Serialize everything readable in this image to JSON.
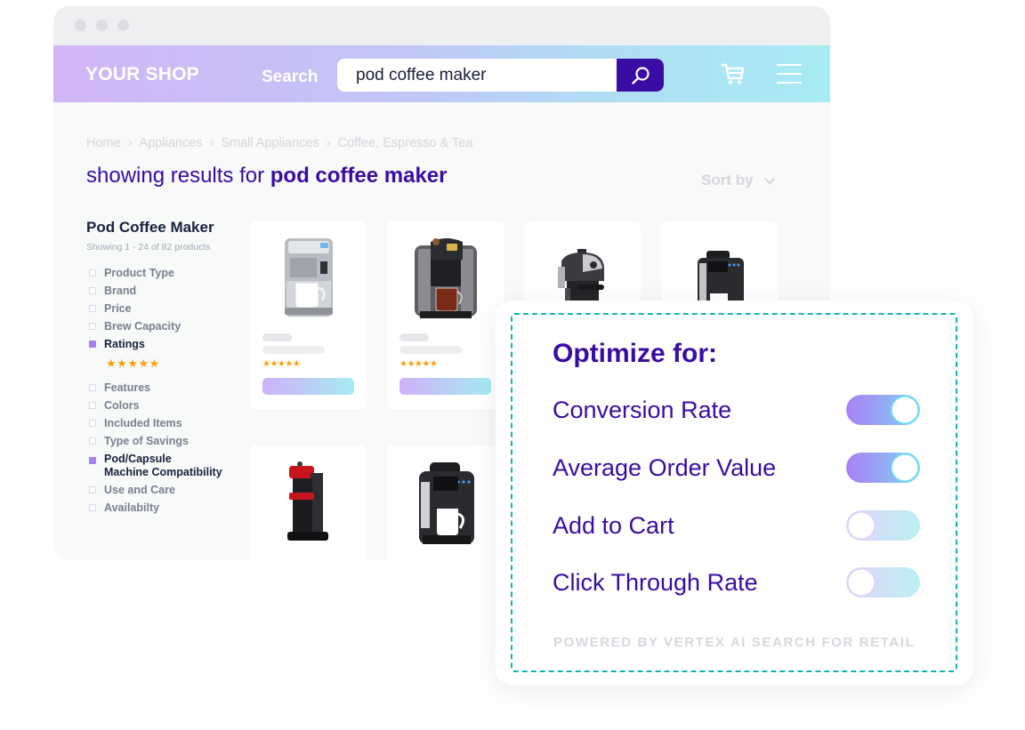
{
  "window": {
    "title_dots": [
      "close",
      "minimize",
      "maximize"
    ]
  },
  "header": {
    "brand": "YOUR SHOP",
    "search_label": "Search",
    "search_value": "pod coffee maker",
    "search_icon": "search-icon",
    "cart_icon": "cart-icon",
    "menu_icon": "hamburger-menu-icon",
    "colors": {
      "accent": "#3a0ca3",
      "gradient_start": "#d3b5f8",
      "gradient_end": "#a7ecf3"
    }
  },
  "breadcrumb": {
    "items": [
      "Home",
      "Appliances",
      "Small Appliances",
      "Coffee, Espresso & Tea"
    ],
    "separator": "›"
  },
  "results": {
    "prefix": "showing results for ",
    "query": "pod coffee maker",
    "sort_label": "Sort by"
  },
  "sidebar": {
    "title": "Pod Coffee Maker",
    "count": "Showing 1 - 24 of 82 products",
    "facets": [
      {
        "label": "Product Type",
        "checked": false
      },
      {
        "label": "Brand",
        "checked": false
      },
      {
        "label": "Price",
        "checked": false
      },
      {
        "label": "Brew Capacity",
        "checked": false
      },
      {
        "label": "Ratings",
        "checked": true,
        "stars": "★★★★★"
      },
      {
        "label": "Features",
        "checked": false
      },
      {
        "label": "Colors",
        "checked": false
      },
      {
        "label": "Included Items",
        "checked": false
      },
      {
        "label": "Type of Savings",
        "checked": false
      },
      {
        "label": "Pod/Capsule Machine Compatibility",
        "line1": "Pod/Capsule",
        "line2": "Machine Compatibility",
        "checked": true
      },
      {
        "label": "Use and Care",
        "checked": false
      },
      {
        "label": "Availabilty",
        "checked": false
      }
    ]
  },
  "products": [
    {
      "name": "silver-pod-coffee-maker",
      "rating": 5,
      "stars": "★★★★★"
    },
    {
      "name": "premium-pod-coffee-maker",
      "rating": 5,
      "stars": "★★★★★"
    },
    {
      "name": "espresso-machine"
    },
    {
      "name": "black-pod-coffee-maker"
    },
    {
      "name": "red-capsule-coffee-maker"
    },
    {
      "name": "classic-black-pod-coffee-maker"
    }
  ],
  "optimize_panel": {
    "title": "Optimize for:",
    "options": [
      {
        "label": "Conversion Rate",
        "enabled": true
      },
      {
        "label": "Average Order Value",
        "enabled": true
      },
      {
        "label": "Add to Cart",
        "enabled": false
      },
      {
        "label": "Click Through Rate",
        "enabled": false
      }
    ],
    "footer": "POWERED BY VERTEX AI SEARCH FOR RETAIL",
    "border_color": "#14b3ba"
  }
}
